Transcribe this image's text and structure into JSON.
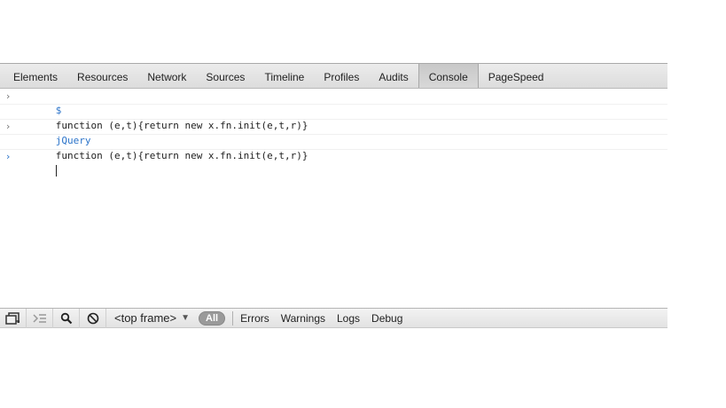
{
  "tabs": [
    {
      "label": "Elements"
    },
    {
      "label": "Resources"
    },
    {
      "label": "Network"
    },
    {
      "label": "Sources"
    },
    {
      "label": "Timeline"
    },
    {
      "label": "Profiles"
    },
    {
      "label": "Audits"
    },
    {
      "label": "Console",
      "selected": true
    },
    {
      "label": "PageSpeed"
    }
  ],
  "console": {
    "messages": [
      {
        "type": "input",
        "text": "$"
      },
      {
        "type": "result",
        "text": "function (e,t){return new x.fn.init(e,t,r)}"
      },
      {
        "type": "input",
        "text": "jQuery"
      },
      {
        "type": "result",
        "text": "function (e,t){return new x.fn.init(e,t,r)}"
      }
    ],
    "prompt_symbol": "›",
    "current_input": ""
  },
  "statusbar": {
    "icons": [
      "dock-icon",
      "show-drawer-icon",
      "search-icon",
      "clear-icon"
    ],
    "frame_select": "<top frame>",
    "filters": {
      "all_label": "All",
      "items": [
        "Errors",
        "Warnings",
        "Logs",
        "Debug"
      ]
    }
  },
  "colors": {
    "input_text": "#2a73c9",
    "toolbar_bg": "#e0e0e0"
  }
}
